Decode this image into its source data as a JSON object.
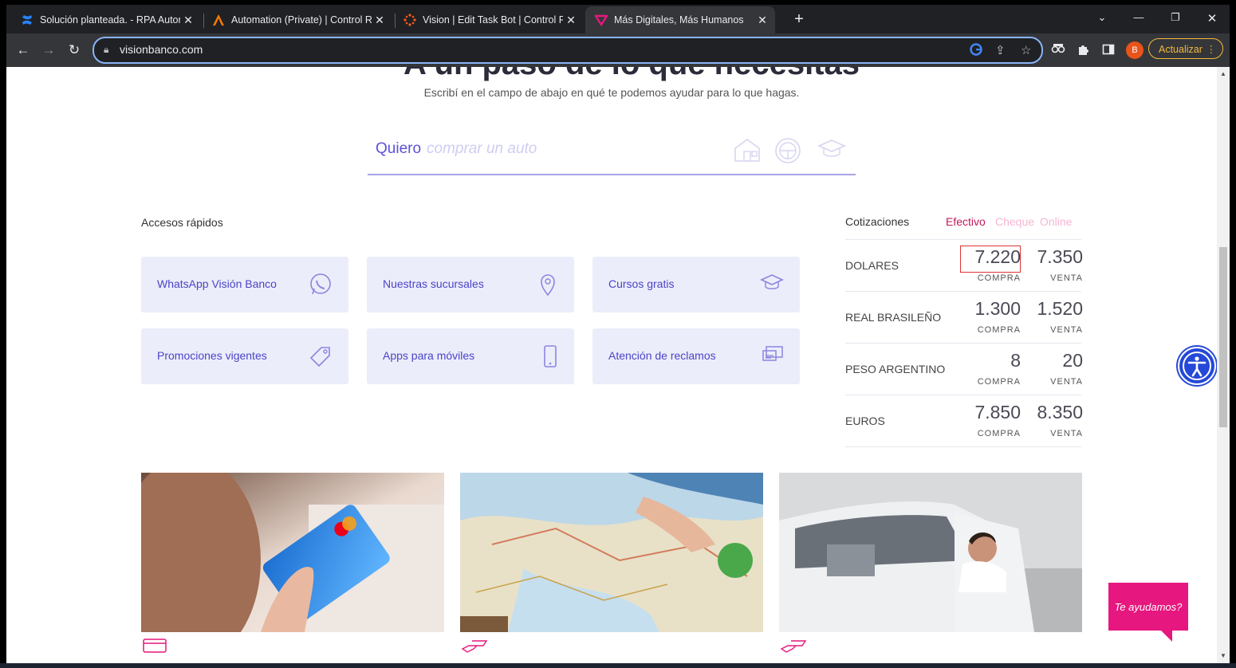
{
  "browser": {
    "tabs": [
      {
        "title": "Solución planteada. - RPA Autom",
        "favicon": "confluence-icon",
        "active": false
      },
      {
        "title": "Automation (Private) | Control Ro",
        "favicon": "automation-anywhere-icon",
        "active": false
      },
      {
        "title": "Vision | Edit Task Bot | Control Ro",
        "favicon": "vision-bot-icon",
        "active": false
      },
      {
        "title": "Más Digitales, Más Humanos",
        "favicon": "vision-banco-icon",
        "active": true
      }
    ],
    "url": "visionbanco.com",
    "update_label": "Actualizar",
    "profile_initial": "B"
  },
  "hero": {
    "title": "A un paso de lo que necesitas",
    "subtitle": "Escribí en el campo de abajo en qué te podemos ayudar para lo que hagas."
  },
  "search": {
    "prefix": "Quiero",
    "placeholder": "comprar un auto"
  },
  "quick_access": {
    "title": "Accesos rápidos",
    "items": [
      {
        "label": "WhatsApp Visión Banco",
        "icon": "whatsapp-icon"
      },
      {
        "label": "Nuestras sucursales",
        "icon": "location-pin-icon"
      },
      {
        "label": "Cursos gratis",
        "icon": "graduation-cap-icon"
      },
      {
        "label": "Promociones vigentes",
        "icon": "price-tag-icon"
      },
      {
        "label": "Apps para móviles",
        "icon": "smartphone-icon"
      },
      {
        "label": "Atención de reclamos",
        "icon": "complaint-monitor-icon"
      }
    ]
  },
  "quotes": {
    "title": "Cotizaciones",
    "tabs": [
      {
        "label": "Efectivo",
        "active": true
      },
      {
        "label": "Cheque",
        "active": false
      },
      {
        "label": "Online",
        "active": false
      }
    ],
    "buy_label": "COMPRA",
    "sell_label": "VENTA",
    "rows": [
      {
        "currency": "DOLARES",
        "buy": "7.220",
        "sell": "7.350"
      },
      {
        "currency": "REAL BRASILEÑO",
        "buy": "1.300",
        "sell": "1.520"
      },
      {
        "currency": "PESO ARGENTINO",
        "buy": "8",
        "sell": "20"
      },
      {
        "currency": "EUROS",
        "buy": "7.850",
        "sell": "8.350"
      }
    ]
  },
  "help_button": "Te ayudamos?",
  "colors": {
    "brand_magenta": "#e6177e",
    "brand_purple": "#4a44c9",
    "card_bg": "#ecedfa",
    "accessibility_blue": "#2448d8"
  }
}
